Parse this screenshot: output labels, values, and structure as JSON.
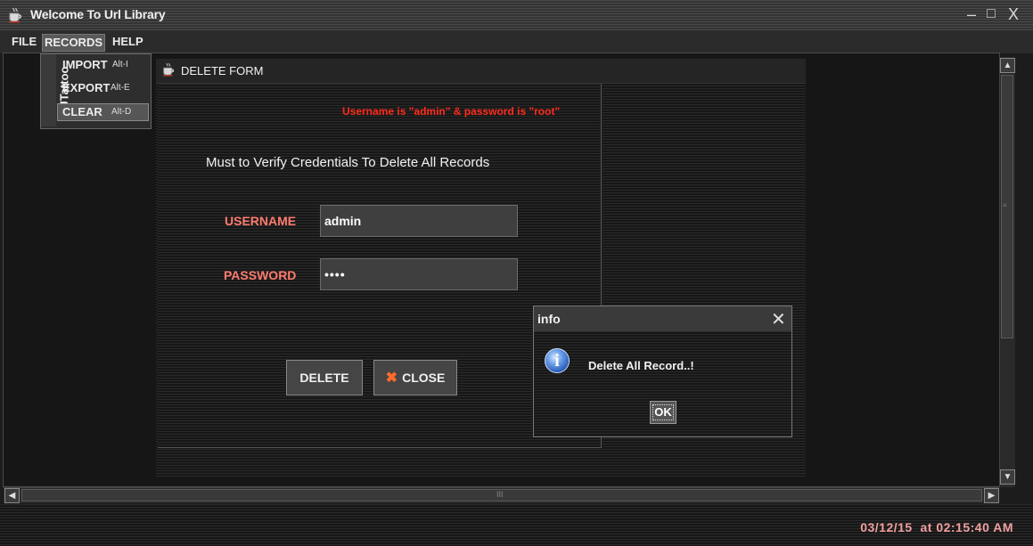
{
  "window": {
    "title": "Welcome To Url Library",
    "icon": "coffee-cup-icon",
    "controls": {
      "minimize": "–",
      "maximize": "□",
      "close": "X"
    }
  },
  "menubar": {
    "items": [
      {
        "label": "FILE"
      },
      {
        "label": "RECORDS"
      },
      {
        "label": "HELP"
      }
    ]
  },
  "records_menu": {
    "side_label": "JTattoo",
    "items": [
      {
        "label": "IMPORT",
        "accelerator": "Alt-I"
      },
      {
        "label": "EXPORT",
        "accelerator": "Alt-E"
      },
      {
        "label": "CLEAR",
        "accelerator": "Alt-D"
      }
    ]
  },
  "delete_form": {
    "title": "DELETE FORM",
    "hint": "Username is \"admin\" & password is \"root\"",
    "instruction": "Must to Verify Credentials To Delete All Records",
    "username_label": "USERNAME",
    "username_value": "admin",
    "password_label": "PASSWORD",
    "password_value": "root",
    "delete_label": "DELETE",
    "close_label": "CLOSE"
  },
  "info_dialog": {
    "title": "info",
    "message": "Delete All Record..!",
    "ok_label": "OK"
  },
  "scrollbars": {
    "grip": "≡",
    "horizontal_grip": "III"
  },
  "status": {
    "datetime": "03/12/15  at 02:15:40 AM"
  },
  "colors": {
    "hint_red": "#ff2a1a",
    "label_salmon": "#ff7b6e",
    "datetime_pink": "#f0a0a0",
    "close_icon_orange": "#ff6a2a"
  }
}
